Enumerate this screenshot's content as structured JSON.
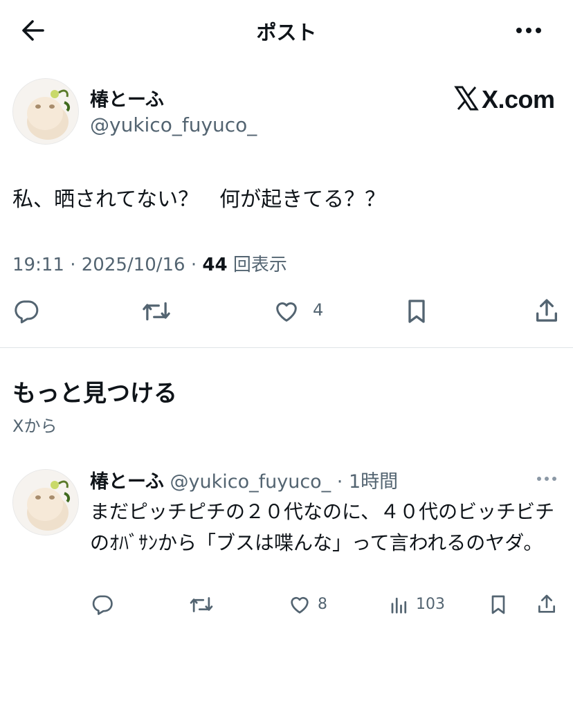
{
  "header": {
    "title": "ポスト",
    "back_icon": "arrow-left-icon",
    "more_icon": "more-horizontal-icon"
  },
  "post": {
    "display_name": "椿とーふ",
    "handle": "@yukico_fuyuco_",
    "watermark": "X.com",
    "text": "私、晒されてない？　何が起きてる？？",
    "time": "19:11",
    "date": "2025/10/16",
    "views_count": "44",
    "views_label": "回表示",
    "actions": {
      "like_count": "4"
    }
  },
  "discover": {
    "title": "もっと見つける",
    "source": "Xから"
  },
  "related": {
    "display_name": "椿とーふ",
    "handle": "@yukico_fuyuco_",
    "age": "1時間",
    "text": "まだピッチピチの２０代なのに、４０代のビッチビチのｵﾊﾞｻﾝから「ブスは喋んな」って言われるのヤダ。",
    "actions": {
      "like_count": "8",
      "views_count": "103"
    }
  },
  "colors": {
    "text": "#0f1419",
    "secondary": "#536471",
    "divider": "#dfe3e6"
  }
}
